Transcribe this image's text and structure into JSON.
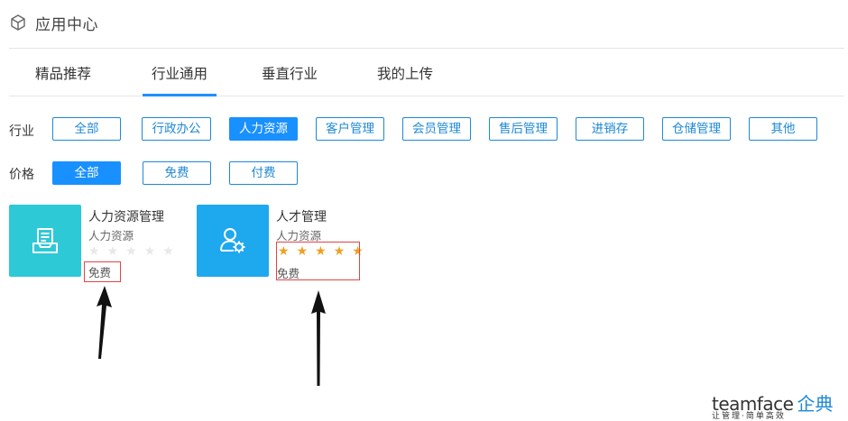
{
  "header": {
    "title": "应用中心",
    "icon": "cube-icon"
  },
  "tabs": [
    {
      "label": "精品推荐",
      "active": false
    },
    {
      "label": "行业通用",
      "active": true
    },
    {
      "label": "垂直行业",
      "active": false
    },
    {
      "label": "我的上传",
      "active": false
    }
  ],
  "filters": {
    "industry": {
      "label": "行业",
      "options": [
        {
          "label": "全部",
          "active": false
        },
        {
          "label": "行政办公",
          "active": false
        },
        {
          "label": "人力资源",
          "active": true
        },
        {
          "label": "客户管理",
          "active": false
        },
        {
          "label": "会员管理",
          "active": false
        },
        {
          "label": "售后管理",
          "active": false
        },
        {
          "label": "进销存",
          "active": false
        },
        {
          "label": "仓储管理",
          "active": false
        },
        {
          "label": "其他",
          "active": false
        }
      ]
    },
    "price": {
      "label": "价格",
      "options": [
        {
          "label": "全部",
          "active": true
        },
        {
          "label": "免费",
          "active": false
        },
        {
          "label": "付费",
          "active": false
        }
      ]
    }
  },
  "apps": [
    {
      "name": "人力资源管理",
      "category": "人力资源",
      "rating": 0,
      "max_rating": 5,
      "price": "免费",
      "icon": "document-tray-icon",
      "color": "#2ec9d6"
    },
    {
      "name": "人才管理",
      "category": "人力资源",
      "rating": 5,
      "max_rating": 5,
      "price": "免费",
      "icon": "user-gear-icon",
      "color": "#1ea8ee"
    }
  ],
  "colors": {
    "accent": "#1890ff",
    "annotation": "#e04545",
    "star": "#f0a020"
  },
  "watermark": {
    "brand_en": "teamface",
    "brand_zh": "企典",
    "slogan": "让管理·简单高效"
  }
}
